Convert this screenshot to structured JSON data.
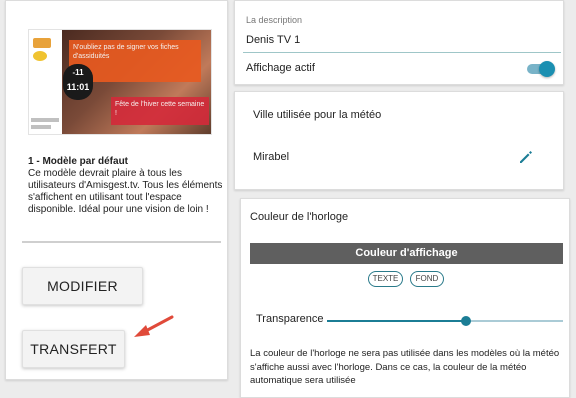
{
  "model": {
    "thumbnail": {
      "banner_top": "N'oubliez pas de signer vos fiches d'assiduités",
      "banner_bottom": "Fête de l'hiver cette semaine !",
      "clock_temp": "-11",
      "clock_time": "11:01"
    },
    "title": "1 - Modèle par défaut",
    "description": "Ce modèle devrait plaire à tous les utilisateurs d'Amisgest.tv. Tous les éléments s'affichent en utilisant tout l'espace disponible. Idéal pour une vision de loin !"
  },
  "actions": {
    "modify_label": "MODIFIER",
    "transfer_label": "TRANSFERT"
  },
  "description_field": {
    "label": "La description",
    "value": "Denis TV 1"
  },
  "active_toggle": {
    "label": "Affichage actif",
    "on": true
  },
  "weather": {
    "title": "Ville utilisée pour la météo",
    "city": "Mirabel",
    "edit_icon": "pencil-icon"
  },
  "clock_color": {
    "title": "Couleur de l'horloge",
    "display_color_label": "Couleur d'affichage",
    "display_color": "#5f5f5f",
    "chips": [
      "TEXTE",
      "FOND"
    ],
    "transparency_label": "Transparence",
    "transparency_fraction": 0.59,
    "note": "La couleur de l'horloge ne sera pas utilisée dans les modèles où la météo s'affiche aussi avec l'horloge. Dans ce cas, la couleur de la météo automatique sera utilisée"
  },
  "colors": {
    "accent": "#1b8fb1",
    "annotation_arrow": "#e04a3a"
  }
}
